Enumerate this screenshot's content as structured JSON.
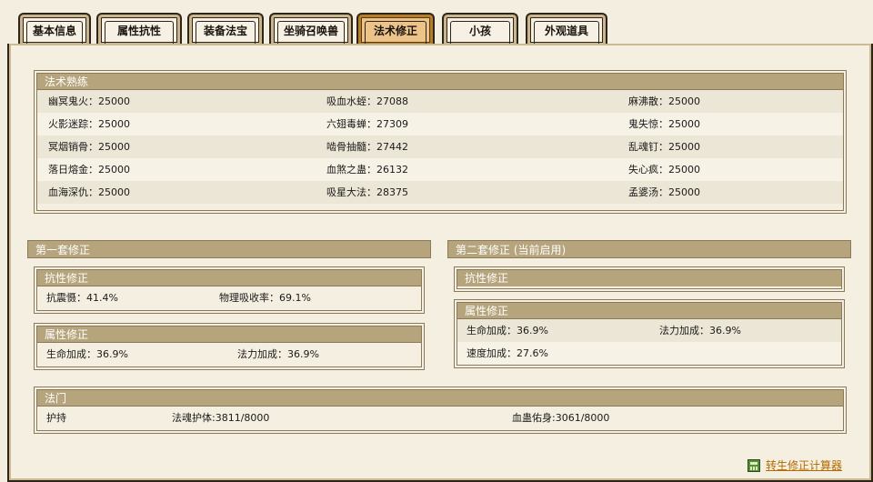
{
  "tabs": [
    {
      "label": "基本信息",
      "active": false
    },
    {
      "label": "属性抗性",
      "active": false
    },
    {
      "label": "装备法宝",
      "active": false
    },
    {
      "label": "坐骑召唤兽",
      "active": false
    },
    {
      "label": "法术修正",
      "active": true
    },
    {
      "label": "小孩",
      "active": false
    },
    {
      "label": "外观道具",
      "active": false
    }
  ],
  "mastery": {
    "title": "法术熟练",
    "rows": [
      [
        "幽冥鬼火：25000",
        "吸血水蛭：27088",
        "麻沸散：25000"
      ],
      [
        "火影迷踪：25000",
        "六翅毒蝉：27309",
        "鬼失惊：25000"
      ],
      [
        "冥烟销骨：25000",
        "啮骨抽髓：27442",
        "乱魂钉：25000"
      ],
      [
        "落日熔金：25000",
        "血煞之蛊：26132",
        "失心疯：25000"
      ],
      [
        "血海深仇：25000",
        "吸星大法：28375",
        "孟婆汤：25000"
      ]
    ]
  },
  "set1": {
    "title": "第一套修正",
    "resist": {
      "title": "抗性修正",
      "items": [
        "抗震慑：41.4%",
        "物理吸收率：69.1%"
      ]
    },
    "attr": {
      "title": "属性修正",
      "items": [
        "生命加成：36.9%",
        "法力加成：36.9%"
      ]
    }
  },
  "set2": {
    "title": "第二套修正 (当前启用)",
    "resist": {
      "title": "抗性修正"
    },
    "attr": {
      "title": "属性修正",
      "row1": [
        "生命加成：36.9%",
        "法力加成：36.9%"
      ],
      "row2": [
        "速度加成：27.6%"
      ]
    }
  },
  "school": {
    "title": "法门",
    "items": [
      "护持",
      "法魂护体:3811/8000",
      "血蛊佑身:3061/8000"
    ]
  },
  "calculator_link": "转生修正计算器",
  "icons": {
    "calculator": "calculator-icon"
  }
}
